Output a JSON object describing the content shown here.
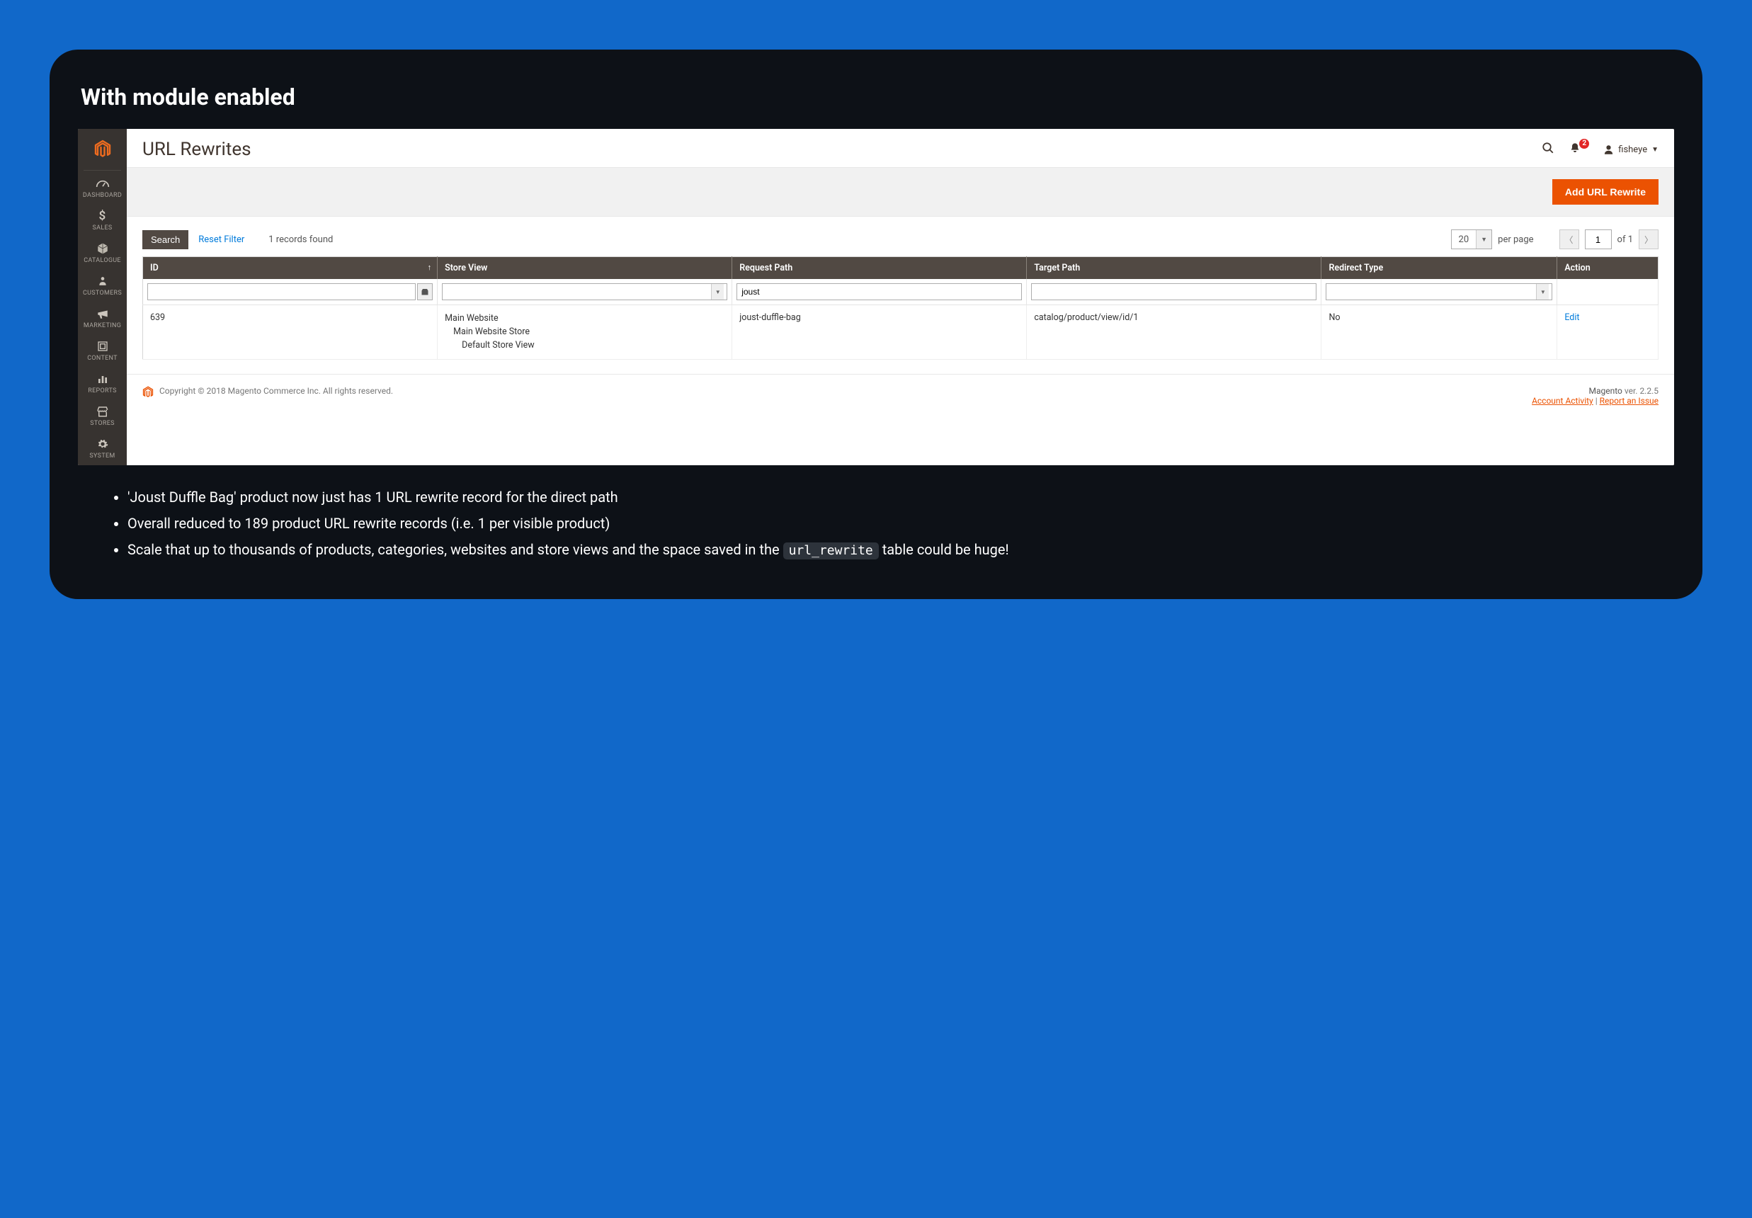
{
  "outer": {
    "title": "With module enabled",
    "bullets": [
      {
        "pre": "'Joust Duffle Bag' product now just has 1 URL rewrite record for the direct path"
      },
      {
        "pre": "Overall reduced to 189 product URL rewrite records (i.e. 1 per visible product)"
      },
      {
        "pre": "Scale that up to thousands of products, categories, websites and store views and the space saved in the ",
        "code": "url_rewrite",
        "post": " table could be huge!"
      }
    ]
  },
  "page": {
    "title": "URL Rewrites",
    "user": "fisheye",
    "notif_badge": "2",
    "add_button": "Add URL Rewrite"
  },
  "sidebar": [
    {
      "label": "DASHBOARD",
      "icon": "dash"
    },
    {
      "label": "SALES",
      "icon": "dollar"
    },
    {
      "label": "CATALOGUE",
      "icon": "cube"
    },
    {
      "label": "CUSTOMERS",
      "icon": "person"
    },
    {
      "label": "MARKETING",
      "icon": "mega"
    },
    {
      "label": "CONTENT",
      "icon": "blocks"
    },
    {
      "label": "REPORTS",
      "icon": "bars"
    },
    {
      "label": "STORES",
      "icon": "store"
    },
    {
      "label": "SYSTEM",
      "icon": "gear"
    }
  ],
  "toolbar": {
    "search": "Search",
    "reset": "Reset Filter",
    "records": "1 records found",
    "page_size": "20",
    "per_page": "per page",
    "page_current": "1",
    "page_of": "of 1"
  },
  "grid": {
    "headers": {
      "id": "ID",
      "store": "Store View",
      "request": "Request Path",
      "target": "Target Path",
      "redirect": "Redirect Type",
      "action": "Action"
    },
    "filters": {
      "request_value": "joust"
    },
    "row": {
      "id": "639",
      "store_l1": "Main Website",
      "store_l2": "Main Website Store",
      "store_l3": "Default Store View",
      "request": "joust-duffle-bag",
      "target": "catalog/product/view/id/1",
      "redirect": "No",
      "action": "Edit"
    }
  },
  "footer": {
    "copyright": "Copyright © 2018 Magento Commerce Inc. All rights reserved.",
    "brand": "Magento",
    "version": " ver. 2.2.5",
    "account": "Account Activity",
    "sep": " | ",
    "report": "Report an Issue"
  }
}
